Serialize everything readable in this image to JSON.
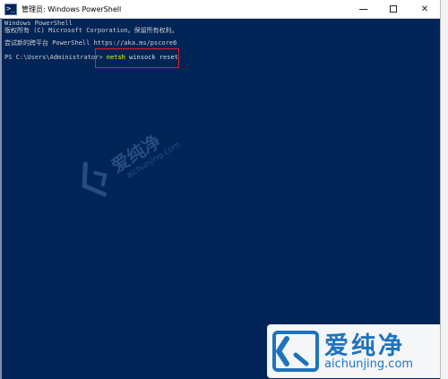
{
  "window": {
    "title": "管理员: Windows PowerShell",
    "app_icon_glyph": ">_",
    "buttons": {
      "minimize": "minimize",
      "maximize": "maximize",
      "close": "✕"
    }
  },
  "console": {
    "lines": [
      "Windows PowerShell",
      "版权所有 (C) Microsoft Corporation。保留所有权利。",
      "尝试新的跨平台 PowerShell https://aka.ms/pscore6"
    ],
    "prompt": "PS C:\\Users\\Administrator> ",
    "command_word": "netsh",
    "command_rest": " winsock reset"
  },
  "colors": {
    "console_background": "#012456",
    "console_text": "#cccccc",
    "command_highlight": "#ffff00",
    "annotation_box": "#e02020",
    "brand_blue": "#1e73be"
  },
  "watermark": {
    "cn_text": "爱纯净",
    "url": "aichunjing.com"
  },
  "logo": {
    "cn_text": "爱纯净",
    "url": "aichunjing.com"
  }
}
